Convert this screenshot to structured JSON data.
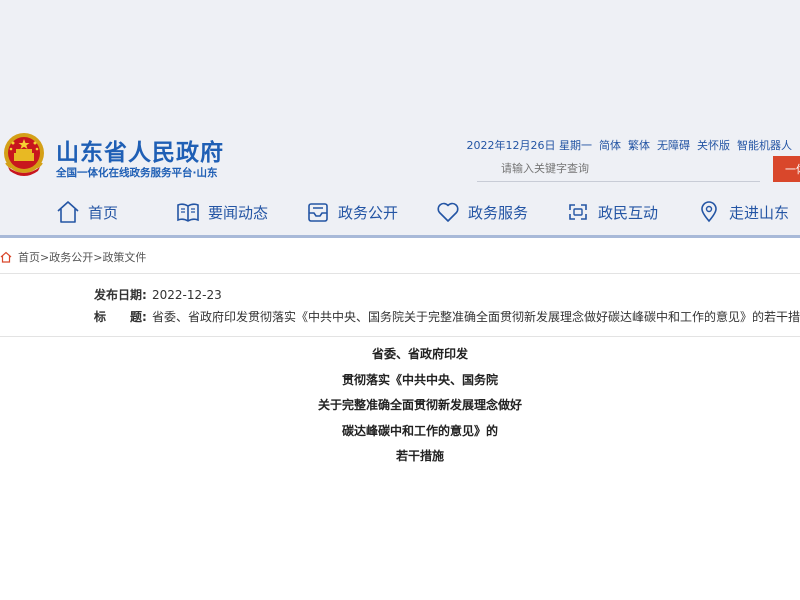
{
  "header": {
    "site_title": "山东省人民政府",
    "site_subtitle": "全国一体化在线政务服务平台·山东",
    "date": "2022年12月26日 星期一",
    "links": [
      "简体",
      "繁体",
      "无障碍",
      "关怀版",
      "智能机器人"
    ],
    "search_placeholder": "请输入关键字查询",
    "search_button": "一体"
  },
  "nav": {
    "items": [
      {
        "label": "首页",
        "icon": "home-icon"
      },
      {
        "label": "要闻动态",
        "icon": "news-icon"
      },
      {
        "label": "政务公开",
        "icon": "inbox-icon"
      },
      {
        "label": "政务服务",
        "icon": "heart-icon"
      },
      {
        "label": "政民互动",
        "icon": "interaction-icon"
      },
      {
        "label": "走进山东",
        "icon": "location-icon"
      }
    ]
  },
  "breadcrumb": [
    "首页",
    ">",
    "政务公开",
    ">",
    "政策文件"
  ],
  "meta": {
    "date_label": "发布日期:",
    "date_value": "2022-12-23",
    "title_label": "标　　题:",
    "title_value": "省委、省政府印发贯彻落实《中共中央、国务院关于完整准确全面贯彻新发展理念做好碳达峰碳中和工作的意见》的若干措施"
  },
  "doc_title_lines": [
    "省委、省政府印发",
    "贯彻落实《中共中央、国务院",
    "关于完整准确全面贯彻新发展理念做好",
    "碳达峰碳中和工作的意见》的",
    "若干措施"
  ],
  "colors": {
    "brand_blue": "#1f5fb5",
    "nav_blue": "#2455a4",
    "accent_red": "#d9472b",
    "band": "#eef0f5"
  }
}
